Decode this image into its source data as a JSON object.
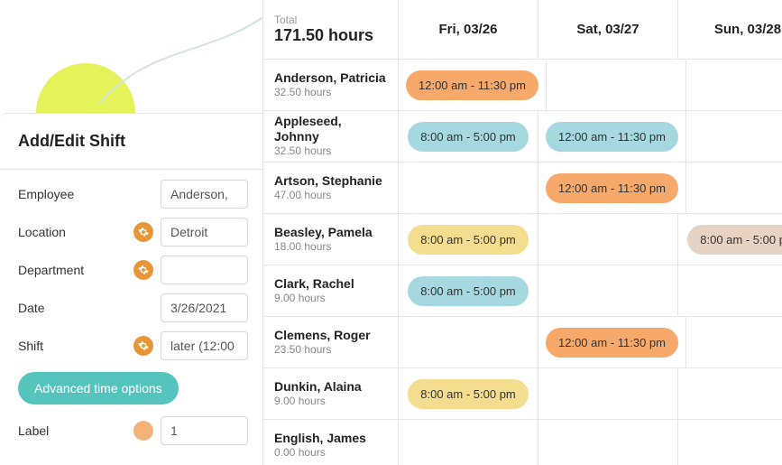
{
  "schedule": {
    "total_label": "Total",
    "total_value": "171.50 hours",
    "days": [
      "Fri, 03/26",
      "Sat, 03/27",
      "Sun, 03/28"
    ],
    "employees": [
      {
        "name": "Anderson, Patricia",
        "hours": "32.50 hours",
        "shifts": {
          "d0": {
            "text": "12:00 am - 11:30 pm",
            "color": "orange"
          }
        }
      },
      {
        "name": "Appleseed, Johnny",
        "hours": "32.50 hours",
        "shifts": {
          "d0": {
            "text": "8:00 am - 5:00 pm",
            "color": "teal"
          },
          "d1": {
            "text": "12:00 am - 11:30 pm",
            "color": "teal"
          }
        }
      },
      {
        "name": "Artson, Stephanie",
        "hours": "47.00 hours",
        "shifts": {
          "d1": {
            "text": "12:00 am - 11:30 pm",
            "color": "orange"
          }
        }
      },
      {
        "name": "Beasley, Pamela",
        "hours": "18.00 hours",
        "shifts": {
          "d0": {
            "text": "8:00 am - 5:00 pm",
            "color": "yellow"
          },
          "d2": {
            "text": "8:00 am - 5:00 pm",
            "color": "tan"
          }
        }
      },
      {
        "name": "Clark, Rachel",
        "hours": "9.00 hours",
        "shifts": {
          "d0": {
            "text": "8:00 am - 5:00 pm",
            "color": "teal"
          }
        }
      },
      {
        "name": "Clemens, Roger",
        "hours": "23.50 hours",
        "shifts": {
          "d1": {
            "text": "12:00 am - 11:30 pm",
            "color": "orange"
          }
        }
      },
      {
        "name": "Dunkin, Alaina",
        "hours": "9.00 hours",
        "shifts": {
          "d0": {
            "text": "8:00 am - 5:00 pm",
            "color": "yellow"
          }
        }
      },
      {
        "name": "English, James",
        "hours": "0.00 hours",
        "shifts": {}
      }
    ]
  },
  "form": {
    "title": "Add/Edit Shift",
    "labels": {
      "employee": "Employee",
      "location": "Location",
      "department": "Department",
      "date": "Date",
      "shift": "Shift",
      "label": "Label"
    },
    "values": {
      "employee": "Anderson,",
      "location": "Detroit",
      "department": "",
      "date": "3/26/2021",
      "shift": "later (12:00",
      "label": "1"
    },
    "advanced_button": "Advanced time options"
  }
}
